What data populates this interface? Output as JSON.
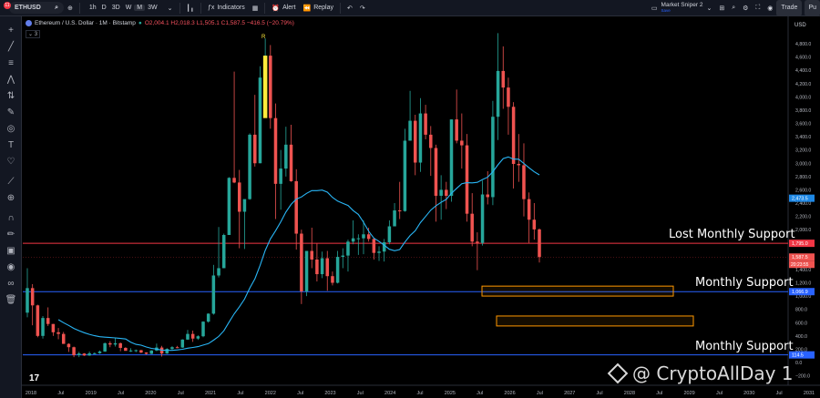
{
  "toolbar": {
    "notif_count": "11",
    "symbol": "ETHUSD",
    "intervals": [
      "1h",
      "D",
      "3D",
      "W",
      "M",
      "3W"
    ],
    "active_interval": "M",
    "indicators": "Indicators",
    "alert": "Alert",
    "replay": "Replay",
    "layout_name": "Market Sniper 2",
    "layout_status": "Save",
    "trade": "Trade"
  },
  "legend": {
    "title": "Ethereum / U.S. Dollar · 1M · Bitstamp",
    "ohlc": "O2,004.1 H2,018.3 L1,505.1 C1,587.5 −416.5 (−20.79%)",
    "indicator_count": "3"
  },
  "annotations": {
    "lost": "Lost Monthly Support",
    "support1": "Monthly Support",
    "support2": "Monthly Support",
    "r_marker": "R"
  },
  "price_axis": {
    "ticks": [
      "4,800.0",
      "4,600.0",
      "4,400.0",
      "4,200.0",
      "4,000.0",
      "3,800.0",
      "3,600.0",
      "3,400.0",
      "3,200.0",
      "3,000.0",
      "2,800.0",
      "2,600.0",
      "2,400.0",
      "2,200.0",
      "2,000.0",
      "1,800.0",
      "1,600.0",
      "1,400.0",
      "1,200.0",
      "1,000.0",
      "800.0",
      "600.0",
      "400.0",
      "200.0",
      "0.0",
      "−200.0"
    ],
    "unit": "USD",
    "tags": {
      "ma": "2,473.5",
      "lost": "1,795.0",
      "last": "1,587.5",
      "countdown": "20:23:55",
      "support1": "1,066.9",
      "support2": "114.5"
    }
  },
  "time_axis": [
    "2018",
    "Jul",
    "2019",
    "Jul",
    "2020",
    "Jul",
    "2021",
    "Jul",
    "2022",
    "Jul",
    "2023",
    "Jul",
    "2024",
    "Jul",
    "2025",
    "Jul",
    "2026",
    "Jul",
    "2027",
    "Jul",
    "2028",
    "Jul",
    "2029",
    "Jul",
    "2030",
    "Jul",
    "2031"
  ],
  "watermark": "@ CryptoAllDay 1",
  "colors": {
    "up": "#26a69a",
    "down": "#ef5350",
    "ma": "#29b6f6",
    "lost_line": "#f23645",
    "support_line": "#2962ff",
    "zone": "#ff9800"
  },
  "chart_data": {
    "type": "candlestick",
    "title": "Ethereum / U.S. Dollar · 1M · Bitstamp",
    "ylim": [
      -200,
      4900
    ],
    "horizontal_levels": [
      {
        "label": "Lost Monthly Support",
        "value": 1795.0
      },
      {
        "label": "Monthly Support",
        "value": 1066.9
      },
      {
        "label": "Monthly Support",
        "value": 114.5
      }
    ],
    "zones": [
      {
        "from": 1000,
        "to": 1150
      },
      {
        "from": 550,
        "to": 700
      }
    ],
    "ma_last": 2473.5,
    "last_price": 1587.5
  }
}
